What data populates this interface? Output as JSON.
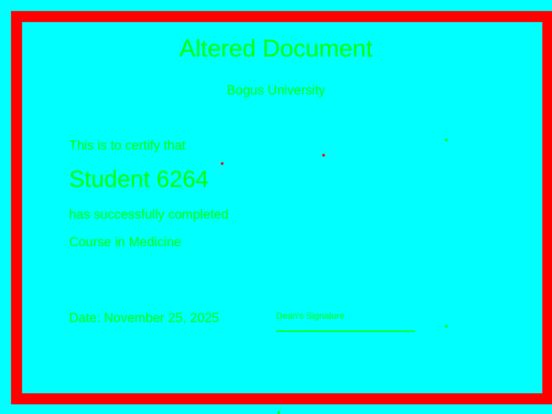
{
  "certificate": {
    "title": "Altered Document",
    "institution": "Bogus University",
    "certify_text": "This is to certify that",
    "student_name": "Student 6264",
    "completion_text": "has successfully completed",
    "course": "Course in Medicine",
    "date_text": "Date: November 25, 2025",
    "signature_label": "Dean's Signature"
  },
  "colors": {
    "background": "#00ffff",
    "border": "#ff0000",
    "text": "#00ff00"
  }
}
